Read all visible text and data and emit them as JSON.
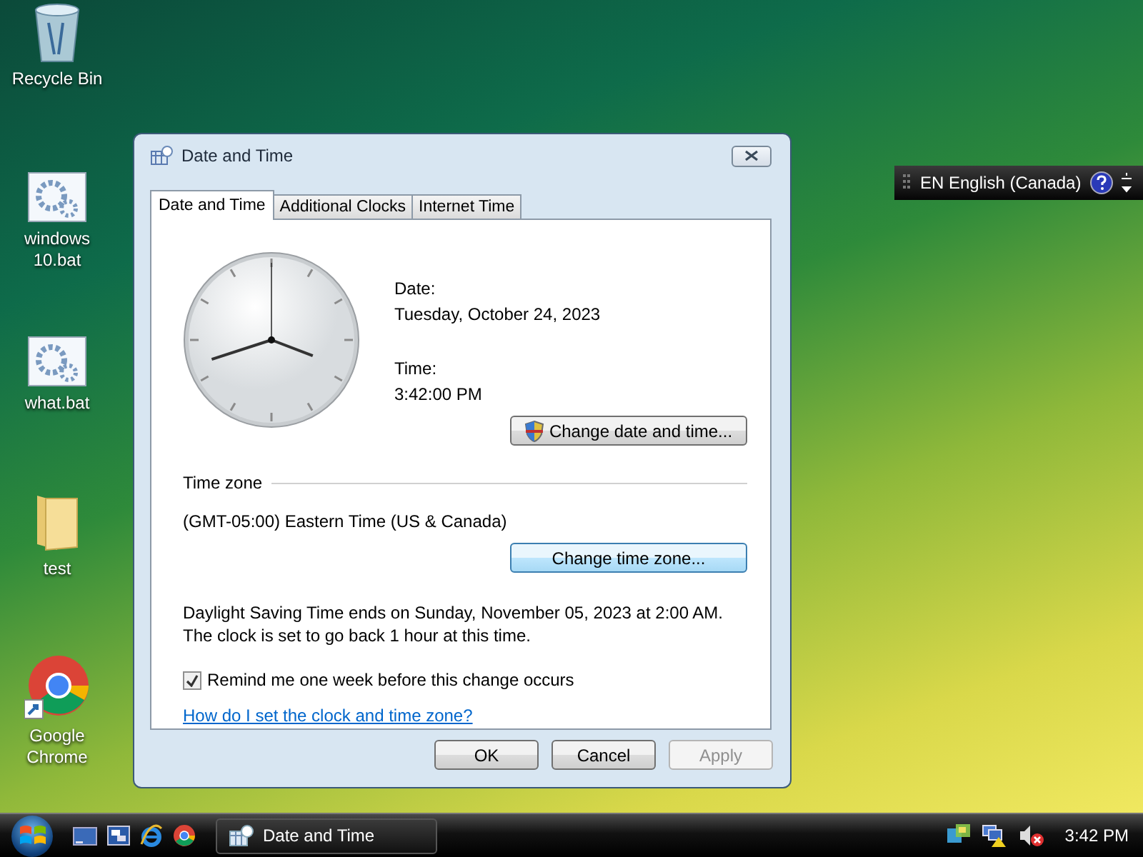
{
  "desktop_icons": [
    {
      "label": "Recycle Bin",
      "kind": "bin"
    },
    {
      "label": "windows 10.bat",
      "kind": "batch"
    },
    {
      "label": "what.bat",
      "kind": "batch"
    },
    {
      "label": "test",
      "kind": "folder"
    },
    {
      "label": "Google Chrome",
      "kind": "browser"
    }
  ],
  "dialog": {
    "title": "Date and Time",
    "tabs": [
      {
        "label": "Date and Time",
        "selected": true
      },
      {
        "label": "Additional Clocks",
        "selected": false
      },
      {
        "label": "Internet Time",
        "selected": false
      }
    ],
    "date_label": "Date:",
    "date_value": "Tuesday, October 24, 2023",
    "time_label": "Time:",
    "time_value": "3:42:00 PM",
    "change_date_button": {
      "label": "Change date and time...",
      "hovered": false
    },
    "time_zone_heading": "Time zone",
    "time_zone": "(GMT-05:00) Eastern Time (US & Canada)",
    "change_zone_button": {
      "label": "Change time zone...",
      "hovered": true
    },
    "dst_note": "Daylight Saving Time ends on Sunday, November 05, 2023 at 2:00 AM. The clock is set to go back 1 hour at this time.",
    "remind": {
      "label": "Remind me one week before this change occurs",
      "checked": true
    },
    "help_link": "How do I set the clock and time zone?",
    "buttons": [
      {
        "label": "OK",
        "disabled": false
      },
      {
        "label": "Cancel",
        "disabled": false
      },
      {
        "label": "Apply",
        "disabled": true
      }
    ]
  },
  "language_bar": {
    "text": "EN English (Canada)"
  },
  "taskbar": {
    "window_button": {
      "label": "Date and Time"
    },
    "clock": "3:42 PM"
  }
}
